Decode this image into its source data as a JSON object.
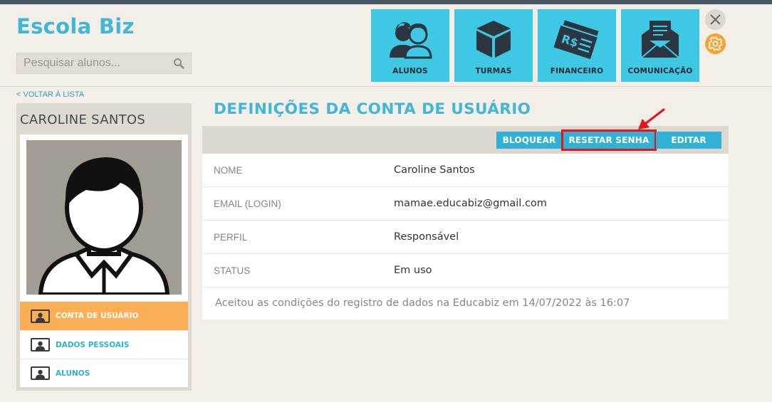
{
  "app": {
    "title": "Escola Biz"
  },
  "search": {
    "placeholder": "Pesquisar alunos..."
  },
  "nav": [
    {
      "label": "ALUNOS",
      "icon": "students-icon"
    },
    {
      "label": "TURMAS",
      "icon": "box-icon"
    },
    {
      "label": "FINANCEIRO",
      "icon": "money-icon"
    },
    {
      "label": "COMUNICAÇÃO",
      "icon": "mail-icon"
    }
  ],
  "back_link": "< VOLTAR À LISTA",
  "sidebar": {
    "name": "CAROLINE SANTOS",
    "items": [
      {
        "label": "CONTA DE USUÁRIO",
        "active": true
      },
      {
        "label": "DADOS PESSOAIS",
        "active": false
      },
      {
        "label": "ALUNOS",
        "active": false
      }
    ]
  },
  "main": {
    "title": "DEFINIÇÕES DA CONTA DE USUÁRIO",
    "buttons": {
      "block": "BLOQUEAR",
      "reset": "RESETAR SENHA",
      "edit": "EDITAR"
    },
    "fields": [
      {
        "key": "NOME",
        "value": "Caroline Santos"
      },
      {
        "key": "EMAIL (LOGIN)",
        "value": "mamae.educabiz@gmail.com"
      },
      {
        "key": "PERFIL",
        "value": "Responsável"
      },
      {
        "key": "STATUS",
        "value": "Em uso"
      }
    ],
    "note": "Aceitou as condições do registro de dados na Educabiz em 14/07/2022 às 16:07"
  },
  "colors": {
    "accent": "#3fb8d8",
    "tile": "#3fc8e4",
    "active": "#fbaf55",
    "highlight": "#e8121a"
  }
}
